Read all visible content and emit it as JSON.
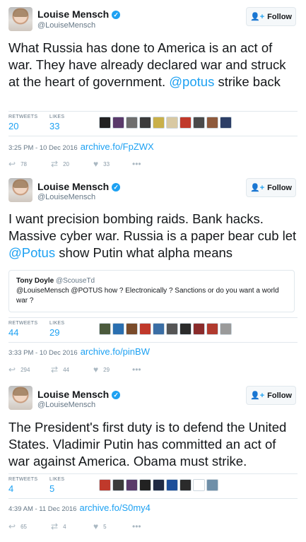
{
  "tweets": [
    {
      "name": "Louise Mensch",
      "handle": "@LouiseMensch",
      "follow_label": "Follow",
      "text_plain": "What Russia has done to America is an act of war. They have already declared war and struck at the heart of government. ",
      "text_mention": "@potus",
      "text_after": " strike back",
      "stats": {
        "retweets_label": "RETWEETS",
        "retweets": "20",
        "likes_label": "LIKES",
        "likes": "33"
      },
      "liker_colors": [
        "#222222",
        "#5a3a6b",
        "#6e6e6e",
        "#3b3b3b",
        "#c9b04a",
        "#d8c9a3",
        "#c0392b",
        "#4a4a4a",
        "#8e5a3c",
        "#2c3e66"
      ],
      "timestamp": "3:25 PM - 10 Dec 2016",
      "archive_link": "archive.fo/FpZWX",
      "actions": {
        "replies": "78",
        "retweets": "20",
        "likes": "33"
      }
    },
    {
      "name": "Louise Mensch",
      "handle": "@LouiseMensch",
      "follow_label": "Follow",
      "text_plain": "I want precision bombing raids. Bank hacks. Massive cyber war. Russia is a paper bear cub let ",
      "text_mention": "@Potus",
      "text_after": " show Putin what alpha means",
      "quote": {
        "name": "Tony Doyle",
        "handle": "@ScouseTd",
        "text": "@LouiseMensch @POTUS how ? Electronically ? Sanctions or do you want a world war ?"
      },
      "stats": {
        "retweets_label": "RETWEETS",
        "retweets": "44",
        "likes_label": "LIKES",
        "likes": "29"
      },
      "liker_colors": [
        "#4b5a3c",
        "#2a6fb0",
        "#7a4b2a",
        "#c0392b",
        "#3a6ea5",
        "#555555",
        "#2b2b2b",
        "#8a2b2b",
        "#b03a2e",
        "#9a9a9a"
      ],
      "timestamp": "3:33 PM - 10 Dec 2016",
      "archive_link": "archive.fo/pinBW",
      "actions": {
        "replies": "294",
        "retweets": "44",
        "likes": "29"
      }
    },
    {
      "name": "Louise Mensch",
      "handle": "@LouiseMensch",
      "follow_label": "Follow",
      "text_plain": "The President's first duty is to defend the United States. Vladimir Putin has committed an act of war against America. Obama must strike.",
      "text_mention": "",
      "text_after": "",
      "stats": {
        "retweets_label": "RETWEETS",
        "retweets": "4",
        "likes_label": "LIKES",
        "likes": "5"
      },
      "liker_colors": [
        "#c0392b",
        "#3b3b3b",
        "#5a3a6b",
        "#222222",
        "#1f2a44",
        "#1c4e9a",
        "#2b2b2b",
        "#ffffff",
        "#6f8fa8"
      ],
      "timestamp": "4:39 AM - 11 Dec 2016",
      "archive_link": "archive.fo/S0my4",
      "actions": {
        "replies": "65",
        "retweets": "4",
        "likes": "5"
      }
    }
  ]
}
